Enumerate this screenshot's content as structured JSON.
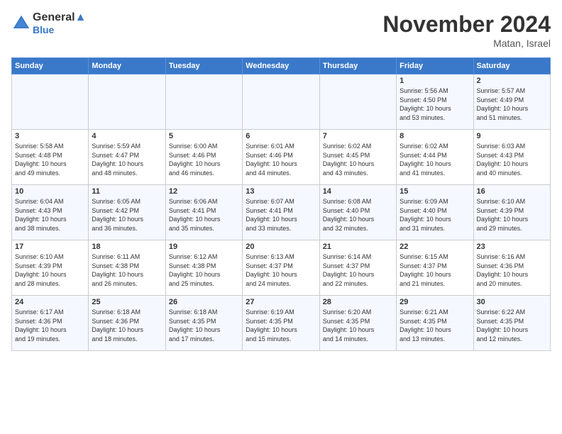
{
  "logo": {
    "line1": "General",
    "line2": "Blue"
  },
  "title": "November 2024",
  "location": "Matan, Israel",
  "days_header": [
    "Sunday",
    "Monday",
    "Tuesday",
    "Wednesday",
    "Thursday",
    "Friday",
    "Saturday"
  ],
  "weeks": [
    [
      {
        "day": "",
        "info": ""
      },
      {
        "day": "",
        "info": ""
      },
      {
        "day": "",
        "info": ""
      },
      {
        "day": "",
        "info": ""
      },
      {
        "day": "",
        "info": ""
      },
      {
        "day": "1",
        "info": "Sunrise: 5:56 AM\nSunset: 4:50 PM\nDaylight: 10 hours\nand 53 minutes."
      },
      {
        "day": "2",
        "info": "Sunrise: 5:57 AM\nSunset: 4:49 PM\nDaylight: 10 hours\nand 51 minutes."
      }
    ],
    [
      {
        "day": "3",
        "info": "Sunrise: 5:58 AM\nSunset: 4:48 PM\nDaylight: 10 hours\nand 49 minutes."
      },
      {
        "day": "4",
        "info": "Sunrise: 5:59 AM\nSunset: 4:47 PM\nDaylight: 10 hours\nand 48 minutes."
      },
      {
        "day": "5",
        "info": "Sunrise: 6:00 AM\nSunset: 4:46 PM\nDaylight: 10 hours\nand 46 minutes."
      },
      {
        "day": "6",
        "info": "Sunrise: 6:01 AM\nSunset: 4:46 PM\nDaylight: 10 hours\nand 44 minutes."
      },
      {
        "day": "7",
        "info": "Sunrise: 6:02 AM\nSunset: 4:45 PM\nDaylight: 10 hours\nand 43 minutes."
      },
      {
        "day": "8",
        "info": "Sunrise: 6:02 AM\nSunset: 4:44 PM\nDaylight: 10 hours\nand 41 minutes."
      },
      {
        "day": "9",
        "info": "Sunrise: 6:03 AM\nSunset: 4:43 PM\nDaylight: 10 hours\nand 40 minutes."
      }
    ],
    [
      {
        "day": "10",
        "info": "Sunrise: 6:04 AM\nSunset: 4:43 PM\nDaylight: 10 hours\nand 38 minutes."
      },
      {
        "day": "11",
        "info": "Sunrise: 6:05 AM\nSunset: 4:42 PM\nDaylight: 10 hours\nand 36 minutes."
      },
      {
        "day": "12",
        "info": "Sunrise: 6:06 AM\nSunset: 4:41 PM\nDaylight: 10 hours\nand 35 minutes."
      },
      {
        "day": "13",
        "info": "Sunrise: 6:07 AM\nSunset: 4:41 PM\nDaylight: 10 hours\nand 33 minutes."
      },
      {
        "day": "14",
        "info": "Sunrise: 6:08 AM\nSunset: 4:40 PM\nDaylight: 10 hours\nand 32 minutes."
      },
      {
        "day": "15",
        "info": "Sunrise: 6:09 AM\nSunset: 4:40 PM\nDaylight: 10 hours\nand 31 minutes."
      },
      {
        "day": "16",
        "info": "Sunrise: 6:10 AM\nSunset: 4:39 PM\nDaylight: 10 hours\nand 29 minutes."
      }
    ],
    [
      {
        "day": "17",
        "info": "Sunrise: 6:10 AM\nSunset: 4:39 PM\nDaylight: 10 hours\nand 28 minutes."
      },
      {
        "day": "18",
        "info": "Sunrise: 6:11 AM\nSunset: 4:38 PM\nDaylight: 10 hours\nand 26 minutes."
      },
      {
        "day": "19",
        "info": "Sunrise: 6:12 AM\nSunset: 4:38 PM\nDaylight: 10 hours\nand 25 minutes."
      },
      {
        "day": "20",
        "info": "Sunrise: 6:13 AM\nSunset: 4:37 PM\nDaylight: 10 hours\nand 24 minutes."
      },
      {
        "day": "21",
        "info": "Sunrise: 6:14 AM\nSunset: 4:37 PM\nDaylight: 10 hours\nand 22 minutes."
      },
      {
        "day": "22",
        "info": "Sunrise: 6:15 AM\nSunset: 4:37 PM\nDaylight: 10 hours\nand 21 minutes."
      },
      {
        "day": "23",
        "info": "Sunrise: 6:16 AM\nSunset: 4:36 PM\nDaylight: 10 hours\nand 20 minutes."
      }
    ],
    [
      {
        "day": "24",
        "info": "Sunrise: 6:17 AM\nSunset: 4:36 PM\nDaylight: 10 hours\nand 19 minutes."
      },
      {
        "day": "25",
        "info": "Sunrise: 6:18 AM\nSunset: 4:36 PM\nDaylight: 10 hours\nand 18 minutes."
      },
      {
        "day": "26",
        "info": "Sunrise: 6:18 AM\nSunset: 4:35 PM\nDaylight: 10 hours\nand 17 minutes."
      },
      {
        "day": "27",
        "info": "Sunrise: 6:19 AM\nSunset: 4:35 PM\nDaylight: 10 hours\nand 15 minutes."
      },
      {
        "day": "28",
        "info": "Sunrise: 6:20 AM\nSunset: 4:35 PM\nDaylight: 10 hours\nand 14 minutes."
      },
      {
        "day": "29",
        "info": "Sunrise: 6:21 AM\nSunset: 4:35 PM\nDaylight: 10 hours\nand 13 minutes."
      },
      {
        "day": "30",
        "info": "Sunrise: 6:22 AM\nSunset: 4:35 PM\nDaylight: 10 hours\nand 12 minutes."
      }
    ]
  ]
}
